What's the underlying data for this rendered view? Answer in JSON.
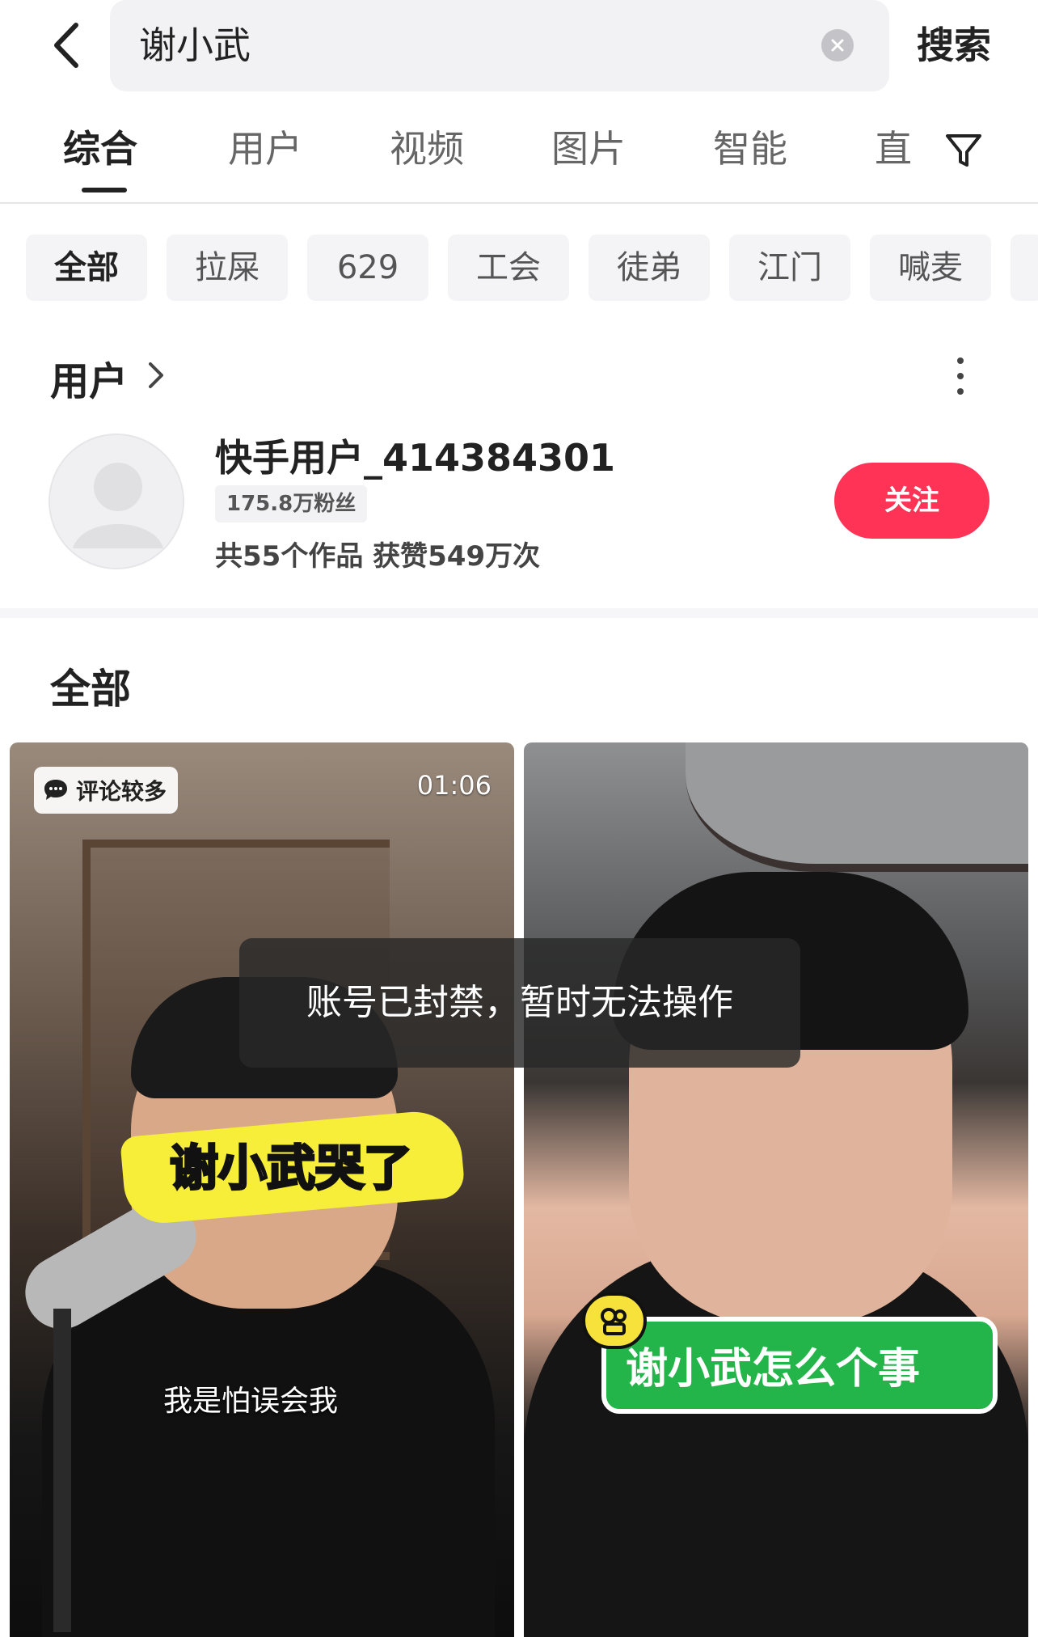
{
  "search": {
    "query": "谢小武",
    "button": "搜索"
  },
  "tabs": [
    "综合",
    "用户",
    "视频",
    "图片",
    "智能",
    "直"
  ],
  "chips": [
    "全部",
    "拉屎",
    "629",
    "工会",
    "徒弟",
    "江门",
    "喊麦"
  ],
  "user_section": {
    "title": "用户",
    "user": {
      "name": "快手用户_414384301",
      "fans": "175.8万粉丝",
      "stats": "共55个作品 获赞549万次",
      "follow_label": "关注"
    }
  },
  "all_section": {
    "title": "全部"
  },
  "videos": [
    {
      "badge": "评论较多",
      "duration": "01:06",
      "caption": "谢小武哭了",
      "subtitle": "我是怕误会我"
    },
    {
      "caption": "谢小武怎么个事"
    }
  ],
  "toast": "账号已封禁，暂时无法操作",
  "colors": {
    "follow": "#fe3355",
    "caption_yellow": "#f6ee38",
    "caption_green": "#23b44a"
  }
}
